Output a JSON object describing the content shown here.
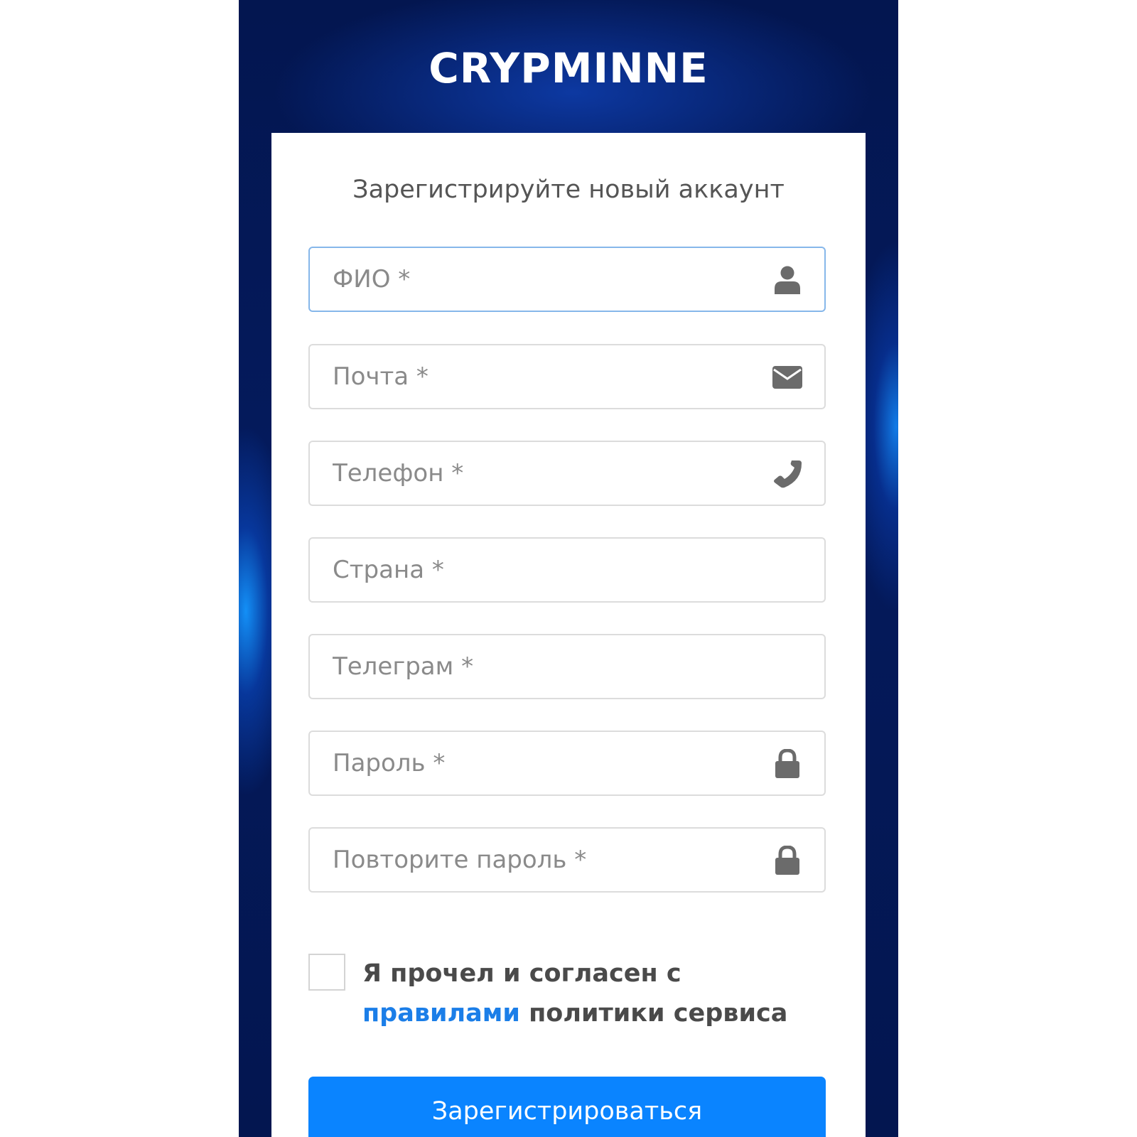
{
  "brand": {
    "logo_text": "CRYPMINNE"
  },
  "form": {
    "title": "Зарегистрируйте новый аккаунт",
    "fields": [
      {
        "name": "full-name",
        "placeholder": "ФИО *",
        "value": "",
        "icon": "user-icon",
        "focused": true
      },
      {
        "name": "email",
        "placeholder": "Почта *",
        "value": "",
        "icon": "envelope-icon"
      },
      {
        "name": "phone",
        "placeholder": "Телефон *",
        "value": "",
        "icon": "phone-icon"
      },
      {
        "name": "country",
        "placeholder": "Страна *",
        "value": ""
      },
      {
        "name": "telegram",
        "placeholder": "Телеграм *",
        "value": ""
      },
      {
        "name": "password",
        "placeholder": "Пароль *",
        "value": "",
        "icon": "lock-icon"
      },
      {
        "name": "password-repeat",
        "placeholder": "Повторите пароль *",
        "value": "",
        "icon": "lock-icon"
      }
    ],
    "consent": {
      "checked": false,
      "text_before": "Я прочел и согласен с ",
      "link_text": "правилами",
      "text_after": " политики сервиса"
    },
    "submit_label": "Зарегистрироваться"
  },
  "colors": {
    "header_bg": "#031650",
    "accent": "#0a84ff",
    "link": "#1b7ee8",
    "icon": "#6b6b6b"
  }
}
